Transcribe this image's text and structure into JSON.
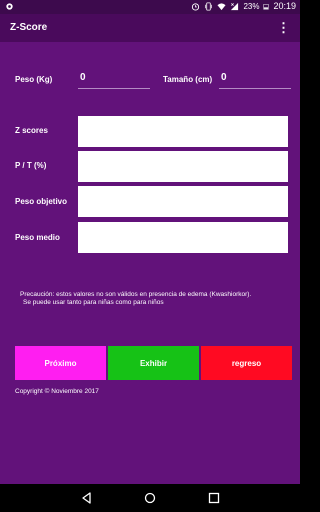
{
  "statusbar": {
    "battery_percent": "23%",
    "time": "20:19"
  },
  "appbar": {
    "title": "Z-Score",
    "menu_glyph": "⋮"
  },
  "form": {
    "weight_label": "Peso (Kg)",
    "weight_value": "0",
    "height_label": "Tamaño (cm)",
    "height_value": "0",
    "zscores_label": "Z scores",
    "pt_label": "P / T (%)",
    "target_weight_label": "Peso objetivo",
    "avg_weight_label": "Peso medio"
  },
  "note": {
    "line1": "Precaución: estos valores no son válidos en presencia de edema (Kwashiorkor).",
    "line2": "Se puede usar tanto para niñas como para niños"
  },
  "buttons": {
    "next": "Próximo",
    "show": "Exhibir",
    "back": "regreso"
  },
  "footer": {
    "copyright": "Copyright © Noviembre 2017"
  },
  "colors": {
    "background": "#62127a",
    "appbar": "#4a0a5c",
    "next_button": "#ff1ef1",
    "show_button": "#16c216",
    "back_button": "#ff0a22"
  }
}
